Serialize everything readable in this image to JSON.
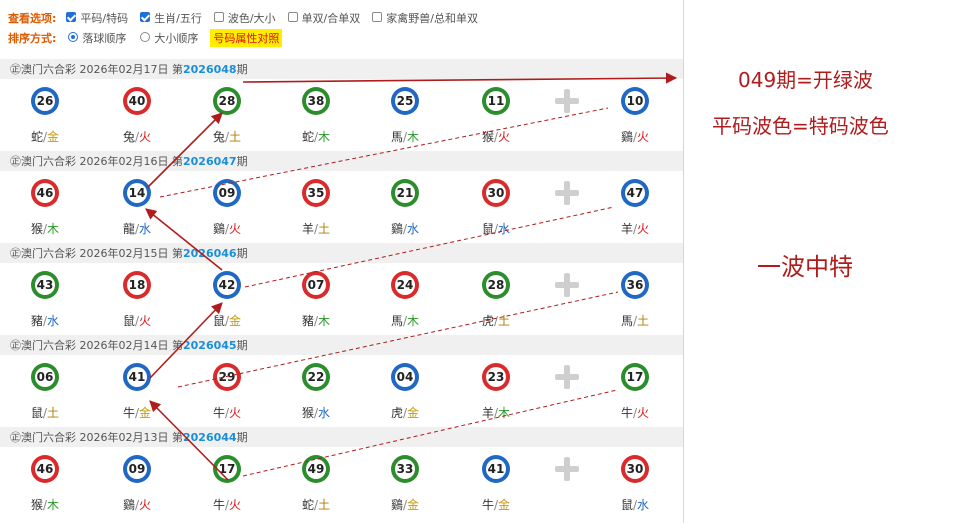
{
  "options": {
    "view_label": "查看选项:",
    "view_items": [
      {
        "label": "平码/特码",
        "checked": true,
        "type": "checkbox"
      },
      {
        "label": "生肖/五行",
        "checked": true,
        "type": "checkbox"
      },
      {
        "label": "波色/大小",
        "checked": false,
        "type": "checkbox"
      },
      {
        "label": "单双/合单双",
        "checked": false,
        "type": "checkbox"
      },
      {
        "label": "家禽野兽/总和单双",
        "checked": false,
        "type": "checkbox"
      }
    ],
    "sort_label": "排序方式:",
    "sort_items": [
      {
        "label": "落球顺序",
        "checked": true
      },
      {
        "label": "大小顺序",
        "checked": false
      }
    ],
    "attr_button": "号码属性对照"
  },
  "colors": {
    "red": "#d92b2b",
    "blue": "#1f68c4",
    "green": "#2c8d2c",
    "annotation": "#b01c1c"
  },
  "draws": [
    {
      "prefix": "㊣澳门六合彩 2026年02月17日 第",
      "issue": "2026048",
      "suffix": "期",
      "balls": [
        {
          "num": "26",
          "color": "blue",
          "zodiac": "蛇",
          "element": "金",
          "el": "gold"
        },
        {
          "num": "40",
          "color": "red",
          "zodiac": "兔",
          "element": "火",
          "el": "fire"
        },
        {
          "num": "28",
          "color": "green",
          "zodiac": "兔",
          "element": "土",
          "el": "earth"
        },
        {
          "num": "38",
          "color": "green",
          "zodiac": "蛇",
          "element": "木",
          "el": "wood"
        },
        {
          "num": "25",
          "color": "blue",
          "zodiac": "馬",
          "element": "木",
          "el": "wood"
        },
        {
          "num": "11",
          "color": "green",
          "zodiac": "猴",
          "element": "火",
          "el": "fire"
        },
        {
          "num": "10",
          "color": "blue",
          "zodiac": "鷄",
          "element": "火",
          "el": "fire"
        }
      ]
    },
    {
      "prefix": "㊣澳门六合彩 2026年02月16日 第",
      "issue": "2026047",
      "suffix": "期",
      "balls": [
        {
          "num": "46",
          "color": "red",
          "zodiac": "猴",
          "element": "木",
          "el": "wood"
        },
        {
          "num": "14",
          "color": "blue",
          "zodiac": "龍",
          "element": "水",
          "el": "water"
        },
        {
          "num": "09",
          "color": "blue",
          "zodiac": "鷄",
          "element": "火",
          "el": "fire"
        },
        {
          "num": "35",
          "color": "red",
          "zodiac": "羊",
          "element": "土",
          "el": "earth"
        },
        {
          "num": "21",
          "color": "green",
          "zodiac": "鷄",
          "element": "水",
          "el": "water"
        },
        {
          "num": "30",
          "color": "red",
          "zodiac": "鼠",
          "element": "水",
          "el": "water"
        },
        {
          "num": "47",
          "color": "blue",
          "zodiac": "羊",
          "element": "火",
          "el": "fire"
        }
      ]
    },
    {
      "prefix": "㊣澳门六合彩 2026年02月15日 第",
      "issue": "2026046",
      "suffix": "期",
      "balls": [
        {
          "num": "43",
          "color": "green",
          "zodiac": "豬",
          "element": "水",
          "el": "water"
        },
        {
          "num": "18",
          "color": "red",
          "zodiac": "鼠",
          "element": "火",
          "el": "fire"
        },
        {
          "num": "42",
          "color": "blue",
          "zodiac": "鼠",
          "element": "金",
          "el": "gold"
        },
        {
          "num": "07",
          "color": "red",
          "zodiac": "豬",
          "element": "木",
          "el": "wood"
        },
        {
          "num": "24",
          "color": "red",
          "zodiac": "馬",
          "element": "木",
          "el": "wood"
        },
        {
          "num": "28",
          "color": "green",
          "zodiac": "虎",
          "element": "土",
          "el": "earth"
        },
        {
          "num": "36",
          "color": "blue",
          "zodiac": "馬",
          "element": "土",
          "el": "earth"
        }
      ]
    },
    {
      "prefix": "㊣澳门六合彩 2026年02月14日 第",
      "issue": "2026045",
      "suffix": "期",
      "balls": [
        {
          "num": "06",
          "color": "green",
          "zodiac": "鼠",
          "element": "土",
          "el": "earth"
        },
        {
          "num": "41",
          "color": "blue",
          "zodiac": "牛",
          "element": "金",
          "el": "gold"
        },
        {
          "num": "29",
          "color": "red",
          "zodiac": "牛",
          "element": "火",
          "el": "fire"
        },
        {
          "num": "22",
          "color": "green",
          "zodiac": "猴",
          "element": "水",
          "el": "water"
        },
        {
          "num": "04",
          "color": "blue",
          "zodiac": "虎",
          "element": "金",
          "el": "gold"
        },
        {
          "num": "23",
          "color": "red",
          "zodiac": "羊",
          "element": "木",
          "el": "wood"
        },
        {
          "num": "17",
          "color": "green",
          "zodiac": "牛",
          "element": "火",
          "el": "fire"
        }
      ]
    },
    {
      "prefix": "㊣澳门六合彩 2026年02月13日 第",
      "issue": "2026044",
      "suffix": "期",
      "balls": [
        {
          "num": "46",
          "color": "red",
          "zodiac": "猴",
          "element": "木",
          "el": "wood"
        },
        {
          "num": "09",
          "color": "blue",
          "zodiac": "鷄",
          "element": "火",
          "el": "fire"
        },
        {
          "num": "17",
          "color": "green",
          "zodiac": "牛",
          "element": "火",
          "el": "fire"
        },
        {
          "num": "49",
          "color": "green",
          "zodiac": "蛇",
          "element": "土",
          "el": "earth"
        },
        {
          "num": "33",
          "color": "green",
          "zodiac": "鷄",
          "element": "金",
          "el": "gold"
        },
        {
          "num": "41",
          "color": "blue",
          "zodiac": "牛",
          "element": "金",
          "el": "gold"
        },
        {
          "num": "30",
          "color": "red",
          "zodiac": "鼠",
          "element": "水",
          "el": "water"
        }
      ]
    }
  ],
  "annotations": {
    "line1": "049期=开绿波",
    "line2": "平码波色=特码波色",
    "line3": "一波中特"
  }
}
